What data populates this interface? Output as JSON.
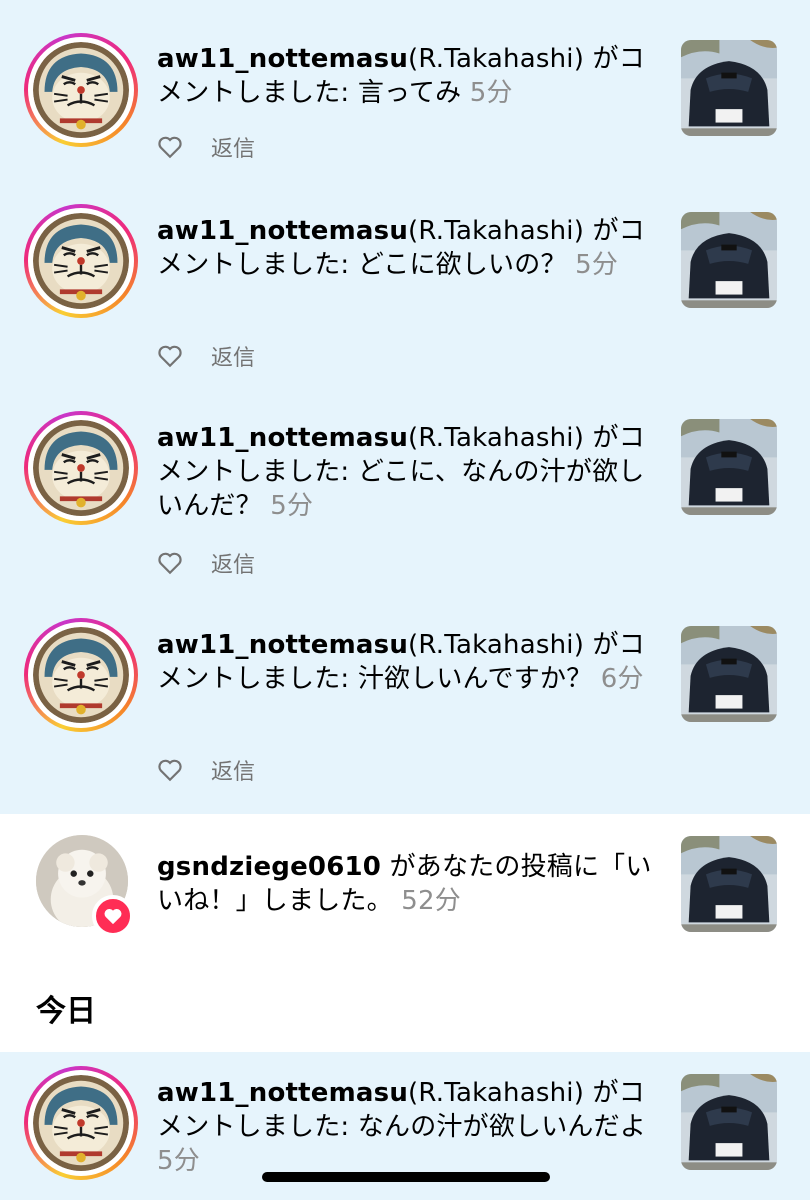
{
  "notifications": [
    {
      "username": "aw11_nottemasu",
      "rest": "(R.Takahashi) がコメントしました: 言ってみ ",
      "time": "5分",
      "reply_label": "返信"
    },
    {
      "username": "aw11_nottemasu",
      "rest": "(R.Takahashi) がコメントしました: どこに欲しいの？ ",
      "time": "5分",
      "reply_label": "返信"
    },
    {
      "username": "aw11_nottemasu",
      "rest": "(R.Takahashi) がコメントしました: どこに、なんの汁が欲しいんだ？ ",
      "time": "5分",
      "reply_label": "返信"
    },
    {
      "username": "aw11_nottemasu",
      "rest": "(R.Takahashi) がコメントしました: 汁欲しいんですか？ ",
      "time": "6分",
      "reply_label": "返信"
    }
  ],
  "like_notification": {
    "username": "gsndziege0610",
    "rest": " があなたの投稿に「いいね！」しました。 ",
    "time": "52分"
  },
  "section": {
    "today_label": "今日"
  },
  "today_notifications": [
    {
      "username": "aw11_nottemasu",
      "rest": "(R.Takahashi) がコメントしました: なんの汁が欲しいんだよ ",
      "time": "5分"
    }
  ],
  "icons": {
    "like": "heart-outline-icon",
    "badge": "heart-filled-icon"
  },
  "colors": {
    "comment_bg": "#e6f4fc",
    "badge": "#ff2d55",
    "time": "#8e8e8e"
  }
}
